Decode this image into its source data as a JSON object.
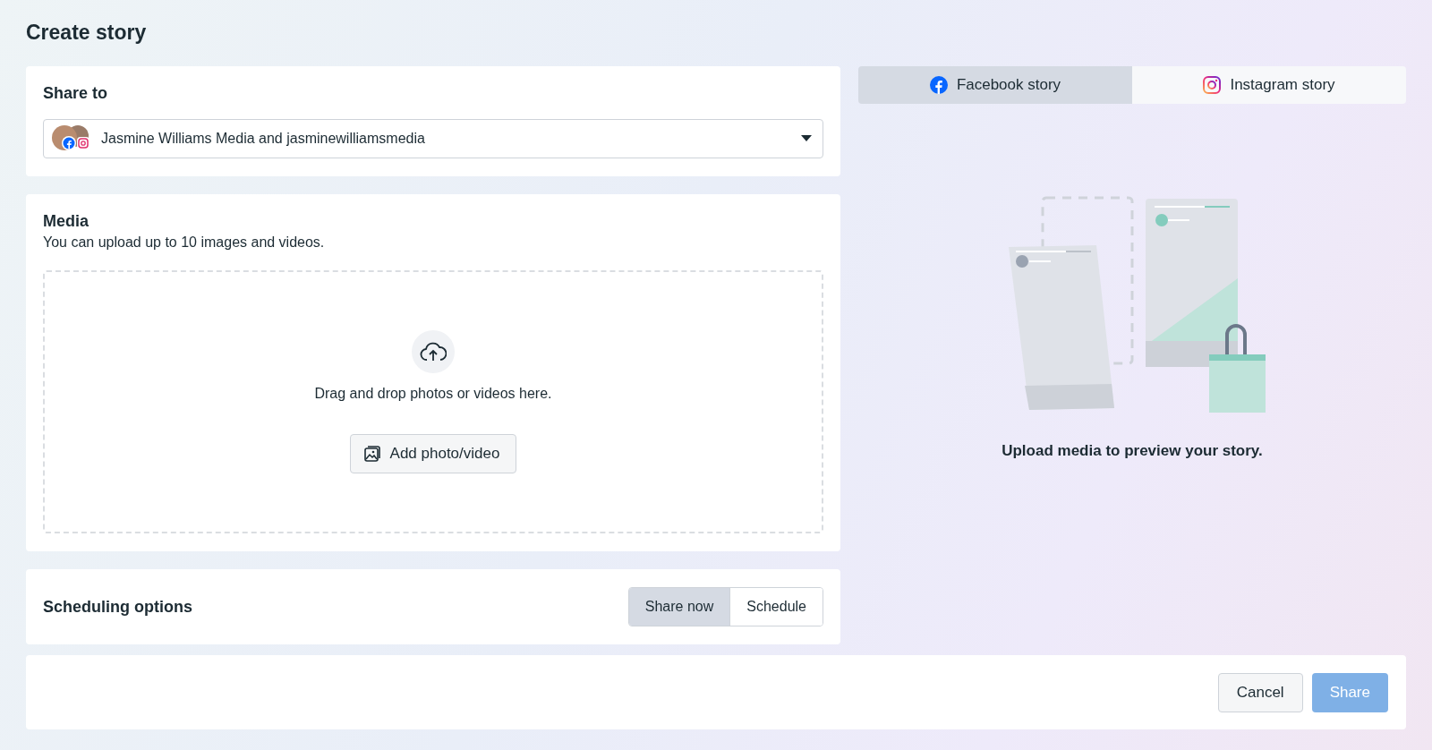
{
  "title": "Create story",
  "share_to": {
    "heading": "Share to",
    "value": "Jasmine Williams Media and jasminewilliamsmedia"
  },
  "media": {
    "heading": "Media",
    "hint": "You can upload up to 10 images and videos.",
    "drop_text": "Drag and drop photos or videos here.",
    "add_button": "Add photo/video"
  },
  "scheduling": {
    "heading": "Scheduling options",
    "options": [
      {
        "label": "Share now",
        "selected": true
      },
      {
        "label": "Schedule",
        "selected": false
      }
    ]
  },
  "preview": {
    "tabs": [
      {
        "label": "Facebook story",
        "kind": "facebook",
        "selected": true
      },
      {
        "label": "Instagram story",
        "kind": "instagram",
        "selected": false
      }
    ],
    "message": "Upload media to preview your story."
  },
  "footer": {
    "buttons": [
      {
        "label": "Cancel",
        "kind": "secondary",
        "disabled": false
      },
      {
        "label": "Share",
        "kind": "primary",
        "disabled": true
      }
    ]
  }
}
